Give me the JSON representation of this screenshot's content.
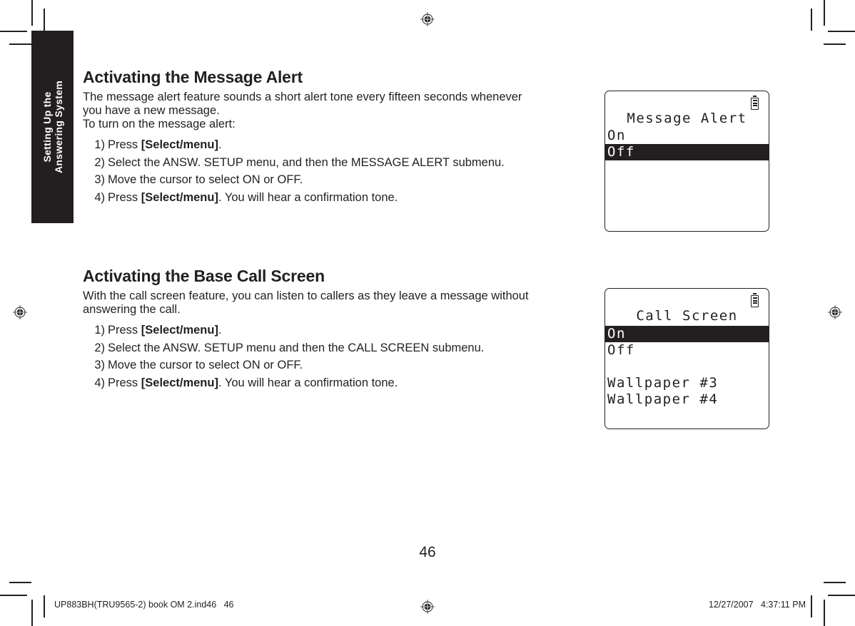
{
  "side_tab": {
    "line1": "Setting Up the",
    "line2": "Answering System",
    "color": "#231f20"
  },
  "sections": [
    {
      "heading": "Activating the Message Alert",
      "intro_lines": [
        "The message alert feature sounds a short alert tone every fifteen seconds whenever",
        "you have a new message.",
        "To turn on the message alert:"
      ],
      "steps": [
        {
          "num": "1)",
          "pre": "Press ",
          "bold": "[Select/menu]",
          "post": "."
        },
        {
          "num": "2)",
          "pre": "Select the ANSW. SETUP menu, and then the MESSAGE ALERT submenu.",
          "bold": "",
          "post": ""
        },
        {
          "num": "3)",
          "pre": "Move the cursor to select ON or OFF.",
          "bold": "",
          "post": ""
        },
        {
          "num": "4)",
          "pre": "Press ",
          "bold": "[Select/menu]",
          "post": ". You will hear a confirmation tone."
        }
      ],
      "lcd": {
        "battery_icon": "battery-icon",
        "title": "Message Alert",
        "rows": [
          {
            "text": "On",
            "selected": false
          },
          {
            "text": "Off",
            "selected": true
          }
        ]
      }
    },
    {
      "heading": "Activating the Base Call Screen",
      "intro_lines": [
        "With the call screen feature, you can listen to callers as they leave a message without",
        "answering the call."
      ],
      "steps": [
        {
          "num": "1)",
          "pre": "Press ",
          "bold": "[Select/menu]",
          "post": "."
        },
        {
          "num": "2)",
          "pre": "Select the ANSW. SETUP menu and then the CALL SCREEN submenu.",
          "bold": "",
          "post": ""
        },
        {
          "num": "3)",
          "pre": "Move the cursor to select ON or OFF.",
          "bold": "",
          "post": ""
        },
        {
          "num": "4)",
          "pre": "Press ",
          "bold": "[Select/menu]",
          "post": ". You will hear a confirmation tone."
        }
      ],
      "lcd": {
        "battery_icon": "battery-icon",
        "title": "Call Screen",
        "rows": [
          {
            "text": "On",
            "selected": true
          },
          {
            "text": "Off",
            "selected": false
          },
          {
            "text": "",
            "selected": false
          },
          {
            "text": "Wallpaper #3",
            "selected": false
          },
          {
            "text": "Wallpaper #4",
            "selected": false
          }
        ]
      }
    }
  ],
  "page_number": "46",
  "slug": {
    "left": "UP883BH(TRU9565-2) book OM 2.ind46   46",
    "right": "12/27/2007   4:37:11 PM"
  },
  "registration_icon": "registration-mark-icon"
}
